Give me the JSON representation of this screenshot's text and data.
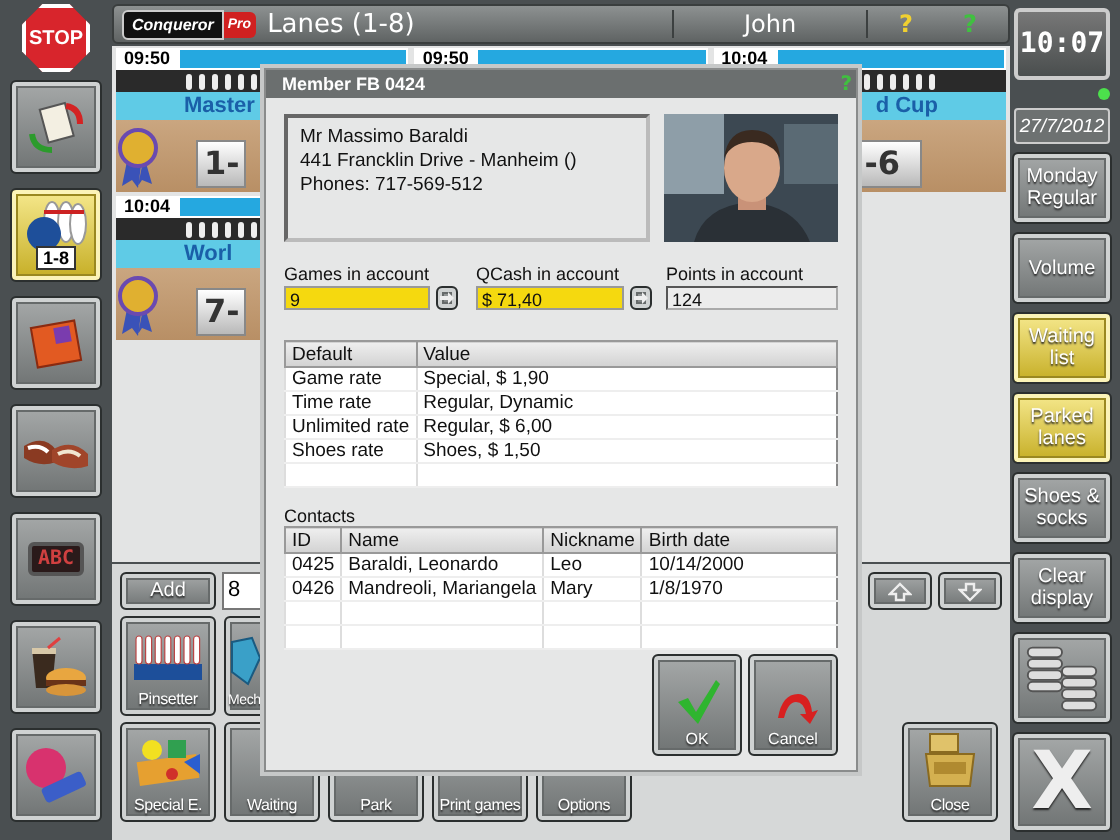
{
  "left_toolbar": [
    {
      "kind": "stop",
      "label": "STOP",
      "selected": false
    },
    {
      "kind": "clipboard",
      "selected": false
    },
    {
      "kind": "pins",
      "label": "1-8",
      "selected": true
    },
    {
      "kind": "scorecard",
      "selected": false
    },
    {
      "kind": "shoes",
      "selected": false
    },
    {
      "kind": "display",
      "label": "ABC",
      "selected": false
    },
    {
      "kind": "food",
      "selected": false
    },
    {
      "kind": "ball",
      "selected": false
    }
  ],
  "top_bar": {
    "logo": "Conqueror",
    "logo_badge": "Pro",
    "title": "Lanes (1-8)",
    "user": "John",
    "help_icons": [
      "?",
      "?"
    ]
  },
  "lanes": [
    {
      "time": "09:50",
      "title": "Master",
      "number": "1-",
      "award": true
    },
    {
      "time": "09:50"
    },
    {
      "time": "10:04",
      "title": "d Cup",
      "number": "-6",
      "award": false
    },
    {
      "time": "10:04",
      "title": "Worl",
      "number": "7-",
      "award": true
    }
  ],
  "lane_entry": {
    "button": "Add",
    "value": "8"
  },
  "function_buttons": [
    [
      {
        "label": "Pinsetter",
        "kind": "pinsetter"
      },
      {
        "label": "Mech",
        "kind": "mechanic"
      }
    ],
    [
      {
        "label": "Special E.",
        "kind": "special"
      },
      {
        "label": "Waiting",
        "kind": "plain"
      },
      {
        "label": "Park",
        "kind": "plain"
      },
      {
        "label": "Print games",
        "kind": "plain"
      },
      {
        "label": "Options",
        "kind": "plain"
      },
      {
        "label": "Close",
        "kind": "close"
      }
    ]
  ],
  "right_panel": {
    "time": "10:07",
    "date": "27/7/2012",
    "buttons": [
      {
        "kind": "text",
        "label": "Monday Regular",
        "highlighted": false
      },
      {
        "kind": "text",
        "label": "Volume",
        "highlighted": false
      },
      {
        "kind": "text",
        "label": "Waiting list",
        "highlighted": true
      },
      {
        "kind": "text",
        "label": "Parked lanes",
        "highlighted": true
      },
      {
        "kind": "text",
        "label": "Shoes & socks",
        "highlighted": false
      },
      {
        "kind": "text",
        "label": "Clear display",
        "highlighted": false
      },
      {
        "kind": "stack",
        "highlighted": false
      },
      {
        "kind": "exit",
        "label": "X",
        "highlighted": false
      }
    ]
  },
  "member_dialog": {
    "title": "Member FB 0424",
    "help": "?",
    "info_lines": [
      "Mr Massimo Baraldi",
      "441 Francklin Drive - Manheim ()",
      "Phones: 717-569-512"
    ],
    "photo": {
      "kind": "picture"
    },
    "accounts": [
      {
        "label": "Games in account",
        "value": "9",
        "kind": "transfer"
      },
      {
        "label": "QCash in account",
        "value": "$ 71,40",
        "kind": "transfer"
      },
      {
        "label": "Points in account",
        "value": "124",
        "kind": "plain"
      }
    ],
    "rates": {
      "columns": [
        "Default",
        "Value"
      ],
      "rows": [
        [
          "Game rate",
          "Special, $ 1,90"
        ],
        [
          "Time rate",
          "Regular, Dynamic"
        ],
        [
          "Unlimited rate",
          "Regular, $ 6,00"
        ],
        [
          "Shoes rate",
          "Shoes, $ 1,50"
        ]
      ]
    },
    "contacts_label": "Contacts",
    "contacts": {
      "columns": [
        "ID",
        "Name",
        "Nickname",
        "Birth date"
      ],
      "rows": [
        [
          "0425",
          "Baraldi, Leonardo",
          "Leo",
          "10/14/2000"
        ],
        [
          "0426",
          "Mandreoli, Mariangela",
          "Mary",
          "1/8/1970"
        ]
      ]
    },
    "buttons": [
      {
        "label": "OK",
        "kind": "ok"
      },
      {
        "label": "Cancel",
        "kind": "cancel"
      }
    ]
  }
}
